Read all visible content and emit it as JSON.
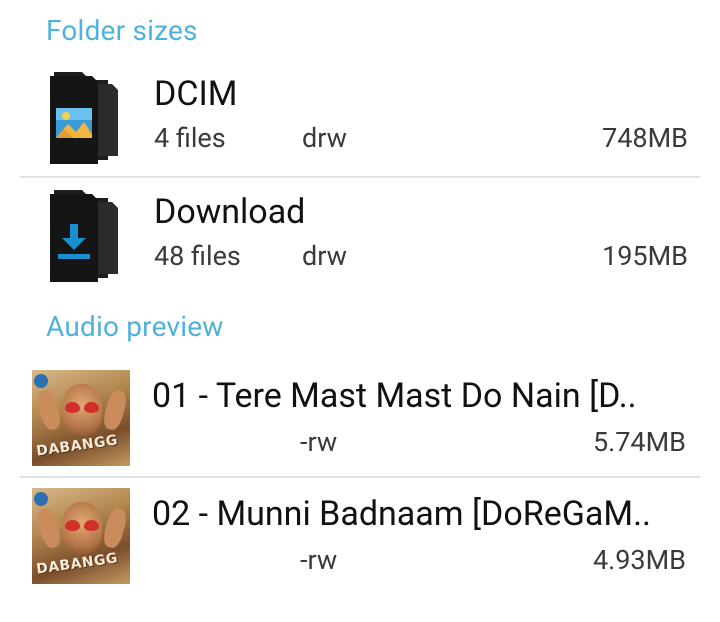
{
  "sections": {
    "folders_header": "Folder sizes",
    "audio_header": "Audio preview"
  },
  "folders": [
    {
      "name": "DCIM",
      "files": "4 files",
      "perms": "drw",
      "size": "748MB",
      "icon": "folder-image-icon"
    },
    {
      "name": "Download",
      "files": "48 files",
      "perms": "drw",
      "size": "195MB",
      "icon": "folder-download-icon"
    }
  ],
  "audio": [
    {
      "title": "01 - Tere Mast Mast Do Nain [D..",
      "perms": "-rw",
      "size": "5.74MB",
      "art_text": "DABANGG"
    },
    {
      "title": "02 - Munni Badnaam [DoReGaM..",
      "perms": "-rw",
      "size": "4.93MB",
      "art_text": "DABANGG"
    }
  ],
  "colors": {
    "accent": "#4fb2dc",
    "divider": "#e2e2e2",
    "icon_blue": "#1a8fd0"
  }
}
